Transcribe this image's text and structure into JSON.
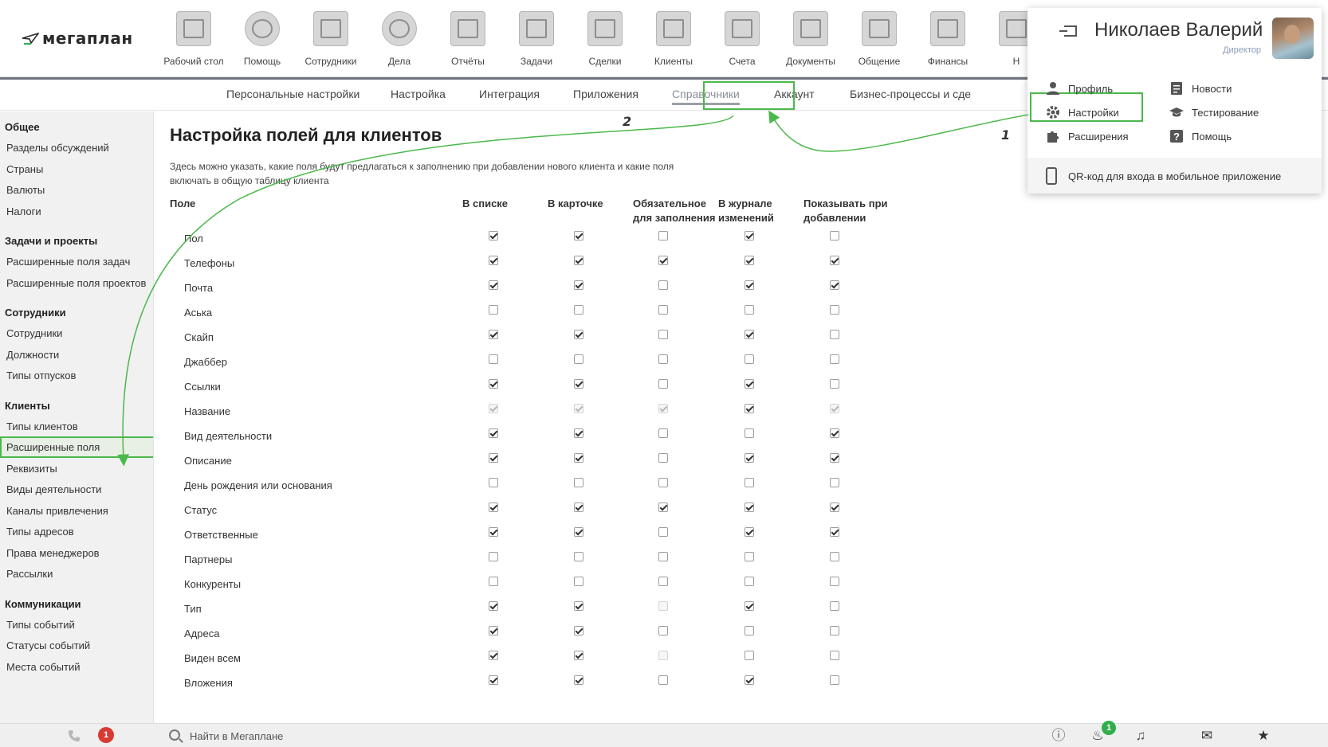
{
  "logo": {
    "text": "мегаплан"
  },
  "modules": [
    {
      "label": "Рабочий стол",
      "icon": "desktop-icon"
    },
    {
      "label": "Помощь",
      "icon": "lifebuoy-icon"
    },
    {
      "label": "Сотрудники",
      "icon": "id-card-icon"
    },
    {
      "label": "Дела",
      "icon": "clock-icon"
    },
    {
      "label": "Отчёты",
      "icon": "chart-icon"
    },
    {
      "label": "Задачи",
      "icon": "clipboard-icon"
    },
    {
      "label": "Сделки",
      "icon": "briefcase-icon"
    },
    {
      "label": "Клиенты",
      "icon": "contacts-book-icon"
    },
    {
      "label": "Счета",
      "icon": "invoice-icon"
    },
    {
      "label": "Документы",
      "icon": "folder-icon"
    },
    {
      "label": "Общение",
      "icon": "chat-icon"
    },
    {
      "label": "Финансы",
      "icon": "safe-icon"
    },
    {
      "label": "Н",
      "icon": "more-icon"
    }
  ],
  "subnav": {
    "tabs": [
      {
        "label": "Персональные настройки"
      },
      {
        "label": "Настройка"
      },
      {
        "label": "Интеграция"
      },
      {
        "label": "Приложения"
      },
      {
        "label": "Справочники",
        "active": true
      },
      {
        "label": "Аккаунт"
      },
      {
        "label": "Бизнес-процессы и сде"
      }
    ]
  },
  "sidebar": {
    "groups": [
      {
        "title": "Общее",
        "items": [
          "Разделы обсуждений",
          "Страны",
          "Валюты",
          "Налоги"
        ]
      },
      {
        "title": "Задачи и проекты",
        "items": [
          "Расширенные поля задач",
          "Расширенные поля проектов"
        ]
      },
      {
        "title": "Сотрудники",
        "items": [
          "Сотрудники",
          "Должности",
          "Типы отпусков"
        ]
      },
      {
        "title": "Клиенты",
        "items": [
          "Типы клиентов",
          "Расширенные поля",
          "Реквизиты",
          "Виды деятельности",
          "Каналы привлечения",
          "Типы адресов",
          "Права менеджеров",
          "Рассылки"
        ]
      },
      {
        "title": "Коммуникации",
        "items": [
          "Типы событий",
          "Статусы событий",
          "Места событий"
        ]
      }
    ],
    "active_item": "Расширенные поля"
  },
  "main": {
    "title": "Настройка полей для клиентов",
    "description": "Здесь можно указать, какие поля будут предлагаться к заполнению при добавлении нового клиента и какие поля включать в общую таблицу клиента",
    "columns": [
      "Поле",
      "В списке",
      "В карточке",
      "Обязательное для заполнения",
      "В журнале изменений",
      "Показывать при добавлении"
    ],
    "rows": [
      {
        "name": "Пол",
        "vals": [
          1,
          1,
          0,
          1,
          0
        ],
        "dis": [
          0,
          0,
          0,
          0,
          0
        ]
      },
      {
        "name": "Телефоны",
        "vals": [
          1,
          1,
          1,
          1,
          1
        ],
        "dis": [
          0,
          0,
          0,
          0,
          0
        ]
      },
      {
        "name": "Почта",
        "vals": [
          1,
          1,
          0,
          1,
          1
        ],
        "dis": [
          0,
          0,
          0,
          0,
          0
        ]
      },
      {
        "name": "Аська",
        "vals": [
          0,
          0,
          0,
          0,
          0
        ],
        "dis": [
          0,
          0,
          0,
          0,
          0
        ]
      },
      {
        "name": "Скайп",
        "vals": [
          1,
          1,
          0,
          1,
          0
        ],
        "dis": [
          0,
          0,
          0,
          0,
          0
        ]
      },
      {
        "name": "Джаббер",
        "vals": [
          0,
          0,
          0,
          0,
          0
        ],
        "dis": [
          0,
          0,
          0,
          0,
          0
        ]
      },
      {
        "name": "Ссылки",
        "vals": [
          1,
          1,
          0,
          1,
          0
        ],
        "dis": [
          0,
          0,
          0,
          0,
          0
        ]
      },
      {
        "name": "Название",
        "vals": [
          1,
          1,
          1,
          1,
          1
        ],
        "dis": [
          1,
          1,
          1,
          0,
          1
        ]
      },
      {
        "name": "Вид деятельности",
        "vals": [
          1,
          1,
          0,
          0,
          1
        ],
        "dis": [
          0,
          0,
          0,
          0,
          0
        ]
      },
      {
        "name": "Описание",
        "vals": [
          1,
          1,
          0,
          1,
          1
        ],
        "dis": [
          0,
          0,
          0,
          0,
          0
        ]
      },
      {
        "name": "День рождения или основания",
        "vals": [
          0,
          0,
          0,
          0,
          0
        ],
        "dis": [
          0,
          0,
          0,
          0,
          0
        ]
      },
      {
        "name": "Статус",
        "vals": [
          1,
          1,
          1,
          1,
          1
        ],
        "dis": [
          0,
          0,
          0,
          0,
          0
        ]
      },
      {
        "name": "Ответственные",
        "vals": [
          1,
          1,
          0,
          1,
          1
        ],
        "dis": [
          0,
          0,
          0,
          0,
          0
        ]
      },
      {
        "name": "Партнеры",
        "vals": [
          0,
          0,
          0,
          0,
          0
        ],
        "dis": [
          0,
          0,
          0,
          0,
          0
        ]
      },
      {
        "name": "Конкуренты",
        "vals": [
          0,
          0,
          0,
          0,
          0
        ],
        "dis": [
          0,
          0,
          0,
          0,
          0
        ]
      },
      {
        "name": "Тип",
        "vals": [
          1,
          1,
          0,
          1,
          0
        ],
        "dis": [
          0,
          0,
          1,
          0,
          0
        ]
      },
      {
        "name": "Адреса",
        "vals": [
          1,
          1,
          0,
          0,
          0
        ],
        "dis": [
          0,
          0,
          0,
          0,
          0
        ]
      },
      {
        "name": "Виден всем",
        "vals": [
          1,
          1,
          0,
          0,
          0
        ],
        "dis": [
          0,
          0,
          1,
          0,
          0
        ]
      },
      {
        "name": "Вложения",
        "vals": [
          1,
          1,
          0,
          1,
          0
        ],
        "dis": [
          0,
          0,
          0,
          0,
          0
        ]
      }
    ]
  },
  "user_menu": {
    "name": "Николаев Валерий",
    "role": "Директор",
    "left_items": [
      {
        "label": "Профиль",
        "icon": "user-icon"
      },
      {
        "label": "Настройки",
        "icon": "gear-icon"
      },
      {
        "label": "Расширения",
        "icon": "puzzle-icon"
      }
    ],
    "right_items": [
      {
        "label": "Новости",
        "icon": "news-icon"
      },
      {
        "label": "Тестирование",
        "icon": "graduation-cap-icon"
      },
      {
        "label": "Помощь",
        "icon": "question-icon"
      }
    ],
    "qr_label": "QR-код для входа в мобильное приложение"
  },
  "bottombar": {
    "search_placeholder": "Найти в Мегаплане",
    "phone_badge": "1",
    "fire_badge": "1"
  },
  "annotations": {
    "step1": "1",
    "step2": "2"
  },
  "colors": {
    "highlight_green": "#4bb84b",
    "nav_border": "#6f7580",
    "badge_red": "#d83b34",
    "badge_green": "#2fae4a"
  }
}
